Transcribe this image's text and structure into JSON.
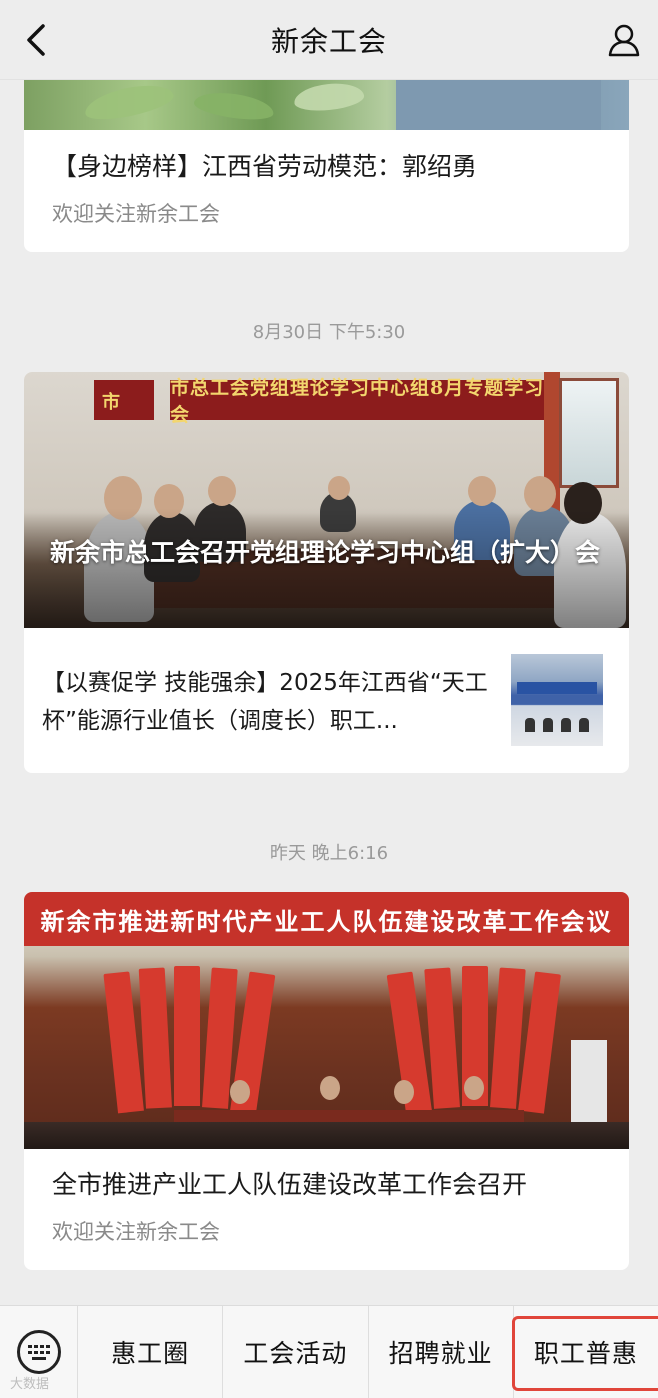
{
  "header": {
    "title": "新余工会",
    "back_icon": "chevron-left-icon",
    "user_icon": "user-icon"
  },
  "articles": [
    {
      "title": "【身边榜样】江西省劳动模范：郭绍勇",
      "subtitle": "欢迎关注新余工会"
    }
  ],
  "groups": [
    {
      "time": "8月30日 下午5:30",
      "main": {
        "image_banner": "市总工会党组理论学习中心组8月专题学习会",
        "side_banner": "市",
        "title": "新余市总工会召开党组理论学习中心组（扩大）会"
      },
      "items": [
        {
          "title": "【以赛促学 技能强余】2025年江西省“天工杯”能源行业值长（调度长）职工..."
        }
      ]
    },
    {
      "time": "昨天 晚上6:16",
      "main": {
        "image_banner": "新余市推进新时代产业工人队伍建设改革工作会议",
        "title": "全市推进产业工人队伍建设改革工作会召开",
        "subtitle": "欢迎关注新余工会"
      }
    }
  ],
  "menu": {
    "keyboard_icon": "keyboard-icon",
    "items": [
      "惠工圈",
      "工会活动",
      "招聘就业",
      "职工普惠"
    ],
    "highlight_color": "#e0453a"
  },
  "watermark": "大数据"
}
